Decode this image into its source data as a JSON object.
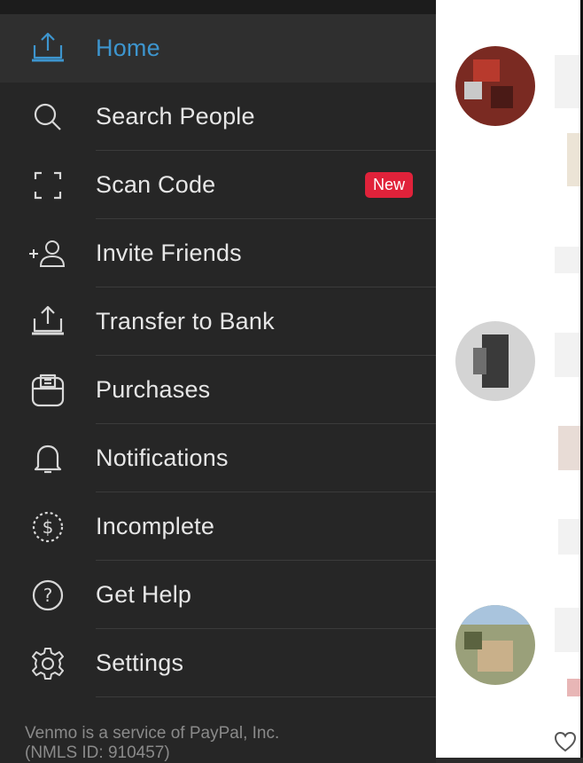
{
  "menu": [
    {
      "label": "Home",
      "icon": "transfer-tray-icon",
      "active": true
    },
    {
      "label": "Search People",
      "icon": "search-icon"
    },
    {
      "label": "Scan Code",
      "icon": "scan-frame-icon",
      "badge": "New"
    },
    {
      "label": "Invite Friends",
      "icon": "add-person-icon"
    },
    {
      "label": "Transfer to Bank",
      "icon": "transfer-tray-icon"
    },
    {
      "label": "Purchases",
      "icon": "receipt-icon"
    },
    {
      "label": "Notifications",
      "icon": "bell-icon"
    },
    {
      "label": "Incomplete",
      "icon": "dollar-circle-icon"
    },
    {
      "label": "Get Help",
      "icon": "help-circle-icon"
    },
    {
      "label": "Settings",
      "icon": "gear-icon"
    }
  ],
  "footer": {
    "line1": "Venmo is a service of PayPal, Inc.",
    "line2": "(NMLS ID: 910457)"
  },
  "colors": {
    "accent": "#3d95ce",
    "badge": "#e0223a",
    "drawer_bg": "#262626"
  }
}
